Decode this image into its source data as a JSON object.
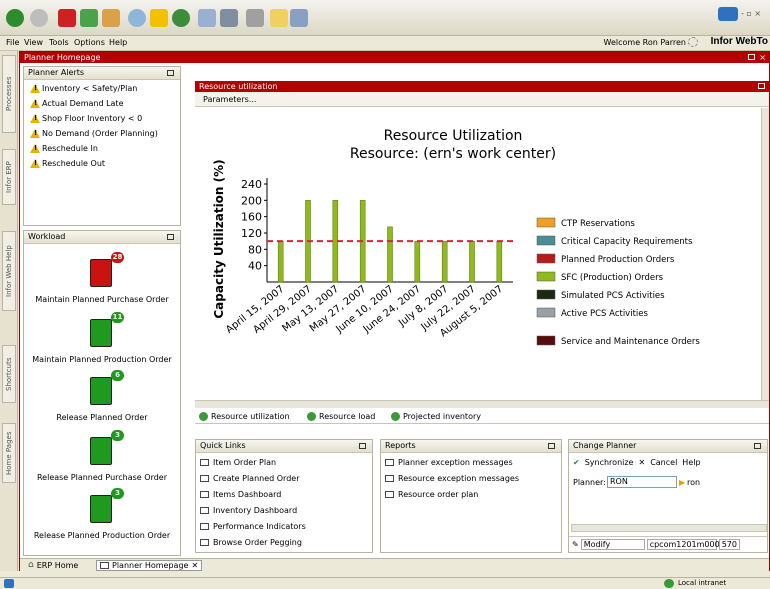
{
  "menubar": {
    "items": [
      "File",
      "View",
      "Tools",
      "Options",
      "Help"
    ],
    "welcome": "Welcome Ron Parren",
    "brand": "Infor WebTo"
  },
  "left_tabs": [
    "Processes",
    "Infor ERP",
    "Infor Web Help",
    "Shortcuts",
    "Home Pages"
  ],
  "main": {
    "title": "Planner Homepage"
  },
  "alerts": {
    "title": "Planner Alerts",
    "items": [
      "Inventory < Safety/Plan",
      "Actual Demand Late",
      "Shop Floor Inventory < 0",
      "No Demand (Order Planning)",
      "Reschedule In",
      "Reschedule Out"
    ]
  },
  "workload": {
    "title": "Workload",
    "items": [
      {
        "label": "Maintain Planned Purchase Order",
        "count": "28",
        "color": "#cc1111"
      },
      {
        "label": "Maintain Planned Production Order",
        "count": "11",
        "color": "#1f9a1f"
      },
      {
        "label": "Release Planned Order",
        "count": "6",
        "color": "#1f9a1f"
      },
      {
        "label": "Release Planned Purchase Order",
        "count": "3",
        "color": "#1f9a1f"
      },
      {
        "label": "Release Planned Production Order",
        "count": "3",
        "color": "#1f9a1f"
      }
    ]
  },
  "resource": {
    "panel_title": "Resource utilization",
    "params": "Parameters..."
  },
  "chart_data": {
    "type": "bar",
    "title": "Resource Utilization",
    "subtitle": "Resource:   (ern's work center)",
    "ylabel": "Capacity Utilization (%)",
    "ylim": [
      0,
      240
    ],
    "yticks": [
      40,
      80,
      120,
      160,
      200,
      240
    ],
    "categories": [
      "April 15, 2007",
      "April 29, 2007",
      "May 13, 2007",
      "May 27, 2007",
      "June 10, 2007",
      "June 24, 2007",
      "July 8, 2007",
      "July 22, 2007",
      "August 5, 2007"
    ],
    "reference_line": 100,
    "reference_color": "#e0203a",
    "series": [
      {
        "name": "SFC (Production) Orders",
        "color": "#8fba1e",
        "values": [
          100,
          200,
          200,
          200,
          135,
          100,
          100,
          100,
          100
        ]
      }
    ],
    "legend": [
      {
        "name": "CTP Reservations",
        "color": "#f0a020"
      },
      {
        "name": "Critical Capacity Requirements",
        "color": "#4c8c96"
      },
      {
        "name": "Planned Production Orders",
        "color": "#b71c1c"
      },
      {
        "name": "SFC (Production) Orders",
        "color": "#8fba1e"
      },
      {
        "name": "Simulated PCS Activities",
        "color": "#1a2a12"
      },
      {
        "name": "Active PCS Activities",
        "color": "#9aa0a4"
      },
      {
        "name": "Service and Maintenance Orders",
        "color": "#5a0c0c"
      }
    ],
    "legend_position": "right"
  },
  "chart_tabs": [
    "Resource utilization",
    "Resource load",
    "Projected inventory"
  ],
  "quick_links": {
    "title": "Quick Links",
    "items": [
      "Item Order Plan",
      "Create Planned Order",
      "Items Dashboard",
      "Inventory Dashboard",
      "Performance Indicators",
      "Browse Order Pegging"
    ]
  },
  "reports": {
    "title": "Reports",
    "items": [
      "Planner exception messages",
      "Resource exception messages",
      "Resource order plan"
    ]
  },
  "change_planner": {
    "title": "Change Planner",
    "synchronize": "Synchronize",
    "cancel": "Cancel",
    "help": "Help",
    "planner_label": "Planner:",
    "planner_value": "RON",
    "planner_name": "ron",
    "mode": "Modify",
    "session": "cpcom1201m000",
    "code": "570"
  },
  "bottom_tabs": [
    "ERP Home",
    "Planner Homepage"
  ],
  "status": {
    "zone": "Local intranet"
  }
}
